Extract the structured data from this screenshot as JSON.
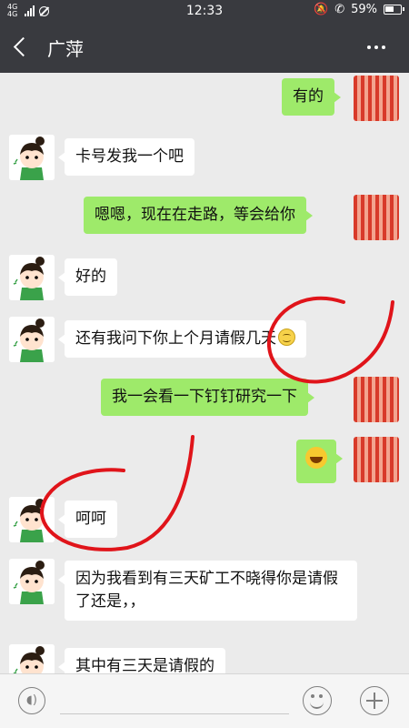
{
  "status_bar": {
    "network": "4G 4G",
    "time": "12:33",
    "battery": "59%",
    "battery_level": 0.59
  },
  "header": {
    "title": "广萍"
  },
  "messages": [
    {
      "sender": "me",
      "text": "有的"
    },
    {
      "sender": "other",
      "text": "卡号发我一个吧"
    },
    {
      "sender": "me",
      "text": "嗯嗯，现在在走路，等会给你"
    },
    {
      "sender": "other",
      "text": "好的"
    },
    {
      "sender": "other",
      "text": "还有我问下你上个月请假几天",
      "emoji": "smile-emoji-icon"
    },
    {
      "sender": "me",
      "text": "我一会看一下钉钉研究一下"
    },
    {
      "sender": "me",
      "emoji": "laughing-crying-emoji-icon"
    },
    {
      "sender": "other",
      "text": "呵呵"
    },
    {
      "sender": "other",
      "text": "因为我看到有三天矿工不晓得你是请假了还是，，"
    },
    {
      "sender": "other",
      "text": "其中有三天是请假的"
    }
  ],
  "input_bar": {
    "voice_icon": "voice-input-icon",
    "emoji_icon": "emoji-icon",
    "more_icon": "add-icon"
  },
  "colors": {
    "header_bg": "#393a3f",
    "chat_bg": "#ebebeb",
    "my_bubble": "#9eea6a",
    "other_bubble": "#ffffff",
    "annotation": "#e0141a"
  }
}
